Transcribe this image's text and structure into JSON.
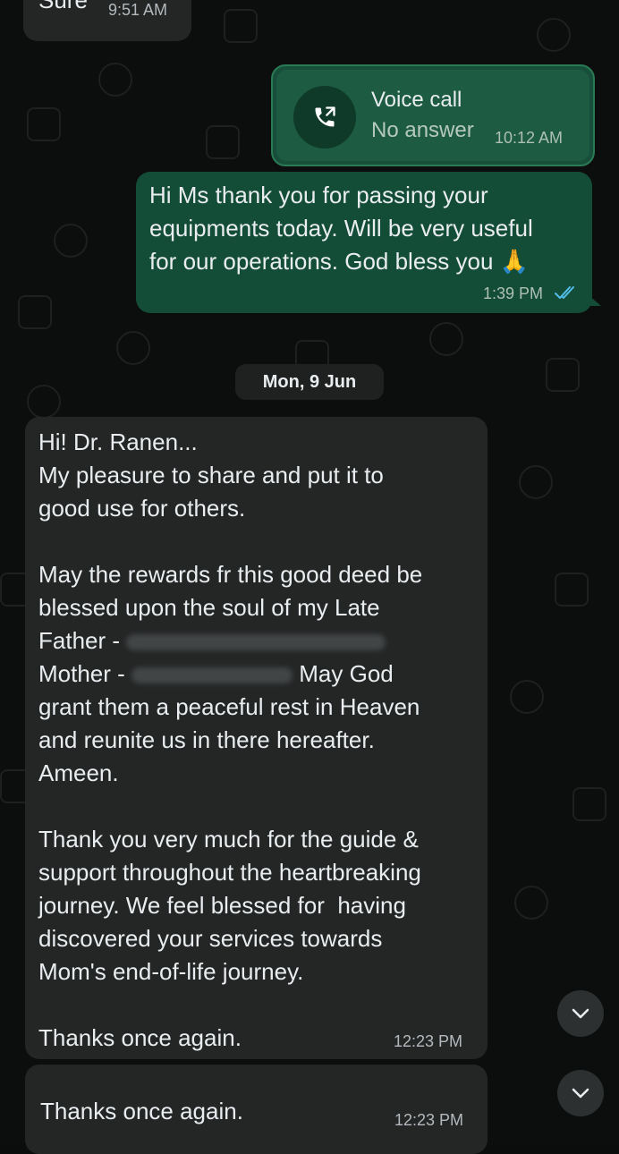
{
  "messages": {
    "sure": {
      "text": "Sure",
      "time": "9:51 AM"
    },
    "voice_call": {
      "title": "Voice call",
      "status": "No answer",
      "time": "10:12 AM",
      "icon": "outgoing-call-icon"
    },
    "outgoing": {
      "text": "Hi Ms thank you for passing your\nequipments today. Will be very useful\nfor our operations. God bless you 🙏",
      "time": "1:39 PM",
      "read_receipt": "double-check-icon",
      "read_color": "#53bdeb"
    },
    "date_divider": "Mon, 9 Jun",
    "long_incoming": {
      "line1": "Hi! Dr. Ranen...\nMy pleasure to share and put it to\ngood use for others.\n\nMay the rewards fr this good deed be\nblessed upon the soul of my Late\nFather - ",
      "line2": "\nMother - ",
      "line3": " May God\ngrant them a peaceful rest in Heaven\nand reunite us in there hereafter.\nAmeen.\n\nThank you very much for the guide &\nsupport throughout the heartbreaking\njourney. We feel blessed for  having\ndiscovered your services towards\nMom's end-of-life journey.\n\nThanks once again.",
      "time": "12:23 PM"
    },
    "short_incoming": {
      "text": "Thanks once again.",
      "time": "12:23 PM"
    }
  },
  "scroll_buttons": {
    "icon": "chevron-down-icon"
  },
  "colors": {
    "incoming_bubble": "#242626",
    "outgoing_bubble": "#144d37",
    "background": "#0b0c0c"
  }
}
